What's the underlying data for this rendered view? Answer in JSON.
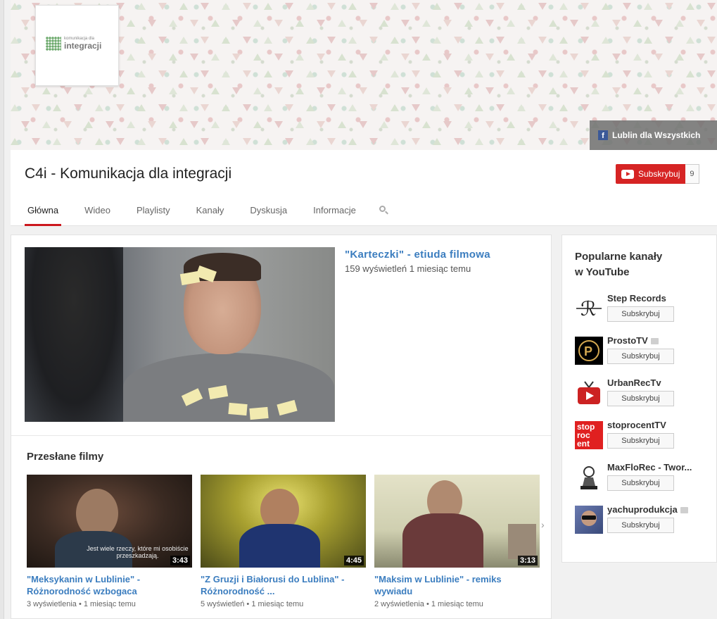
{
  "banner": {
    "logo_small": "komunikacja dla",
    "logo_main": "integracji",
    "facebook_link": "Lublin dla Wszystkich"
  },
  "header": {
    "channel_title": "C4i - Komunikacja dla integracji",
    "subscribe_label": "Subskrybuj",
    "subscriber_count": "9",
    "tabs": [
      "Główna",
      "Wideo",
      "Playlisty",
      "Kanały",
      "Dyskusja",
      "Informacje"
    ]
  },
  "featured": {
    "title": "\"Karteczki\" - etiuda filmowa",
    "stats": "159 wyświetleń  1 miesiąc temu"
  },
  "uploads": {
    "section_title": "Przesłane filmy",
    "videos": [
      {
        "title": "\"Meksykanin w Lublinie\" - Różnorodność wzbogaca",
        "stats": "3 wyświetlenia • 1 miesiąc temu",
        "duration": "3:43",
        "overlay": "Jest wiele rzeczy, które mi osobiście przeszkadzają."
      },
      {
        "title": "\"Z Gruzji i Białorusi do Lublina\" - Różnorodność ...",
        "stats": "5 wyświetleń • 1 miesiąc temu",
        "duration": "4:45"
      },
      {
        "title": "\"Maksim w Lublinie\" - remiks wywiadu",
        "stats": "2 wyświetlenia • 1 miesiąc temu",
        "duration": "3:13"
      }
    ]
  },
  "sidebar": {
    "title_line1": "Popularne kanały",
    "title_line2": "w YouTube",
    "subscribe_label": "Subskrybuj",
    "channels": [
      {
        "name": "Step Records"
      },
      {
        "name": "ProstoTV"
      },
      {
        "name": "UrbanRecTv"
      },
      {
        "name": "stoprocentTV"
      },
      {
        "name": "MaxFloRec - Twor..."
      },
      {
        "name": "yachuprodukcja"
      }
    ],
    "stop_logo_text": [
      "stop",
      "roc",
      "ent"
    ]
  },
  "colors": {
    "accent": "#cc181e",
    "link": "#3b7dbf",
    "subscribe": "#d62424"
  }
}
